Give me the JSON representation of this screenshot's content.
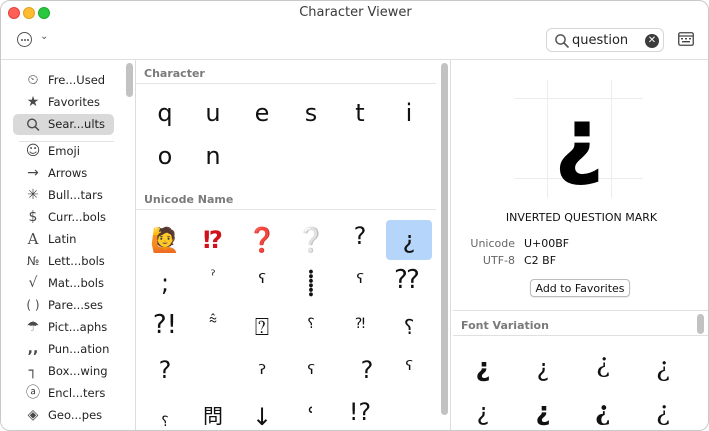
{
  "window": {
    "title": "Character Viewer"
  },
  "search": {
    "value": "question"
  },
  "sidebar": {
    "items": [
      {
        "label": "Fre...Used",
        "icon": "⏲"
      },
      {
        "label": "Favorites",
        "icon": "★"
      },
      {
        "label": "Sear...ults",
        "icon": ""
      },
      {
        "label": "Emoji",
        "icon": "☺"
      },
      {
        "label": "Arrows",
        "icon": "→"
      },
      {
        "label": "Bull...tars",
        "icon": "✳"
      },
      {
        "label": "Curr...bols",
        "icon": "$"
      },
      {
        "label": "Latin",
        "icon": "A"
      },
      {
        "label": "Lett...bols",
        "icon": "№"
      },
      {
        "label": "Mat...bols",
        "icon": "√"
      },
      {
        "label": "Pare...ses",
        "icon": "( )"
      },
      {
        "label": "Pict...aphs",
        "icon": "☂"
      },
      {
        "label": "Pun...ation",
        "icon": ",,"
      },
      {
        "label": "Box...wing",
        "icon": "┐"
      },
      {
        "label": "Encl...ters",
        "icon": "ⓐ"
      },
      {
        "label": "Geo...pes",
        "icon": "◈"
      }
    ]
  },
  "character_section": {
    "heading": "Character",
    "chars": [
      "q",
      "u",
      "e",
      "s",
      "t",
      "i",
      "o",
      "n"
    ]
  },
  "unicode_section": {
    "heading": "Unicode Name",
    "chars": [
      "🙋",
      "⁉",
      "❓",
      "❔",
      "?",
      "¿",
      ";",
      "ˀ",
      "ˤ",
      "⸽",
      "ˁ",
      "⁇",
      "?!",
      "⩯",
      "⍰",
      "⸮",
      "⁈",
      "⸮",
      "?",
      "ˀ",
      "ˁ",
      "?",
      "ˤ",
      "?",
      "⸮",
      "問",
      "↓",
      "ʿ",
      "!?",
      ""
    ]
  },
  "detail": {
    "glyph": "¿",
    "name": "INVERTED QUESTION MARK",
    "unicode_label": "Unicode",
    "unicode_value": "U+00BF",
    "utf8_label": "UTF-8",
    "utf8_value": "C2 BF",
    "favorites_button": "Add to Favorites"
  },
  "font_variation": {
    "heading": "Font Variation",
    "glyphs": [
      "¿",
      "¿",
      "¿",
      "¿",
      "¿",
      "¿",
      "¿",
      "¿"
    ]
  }
}
